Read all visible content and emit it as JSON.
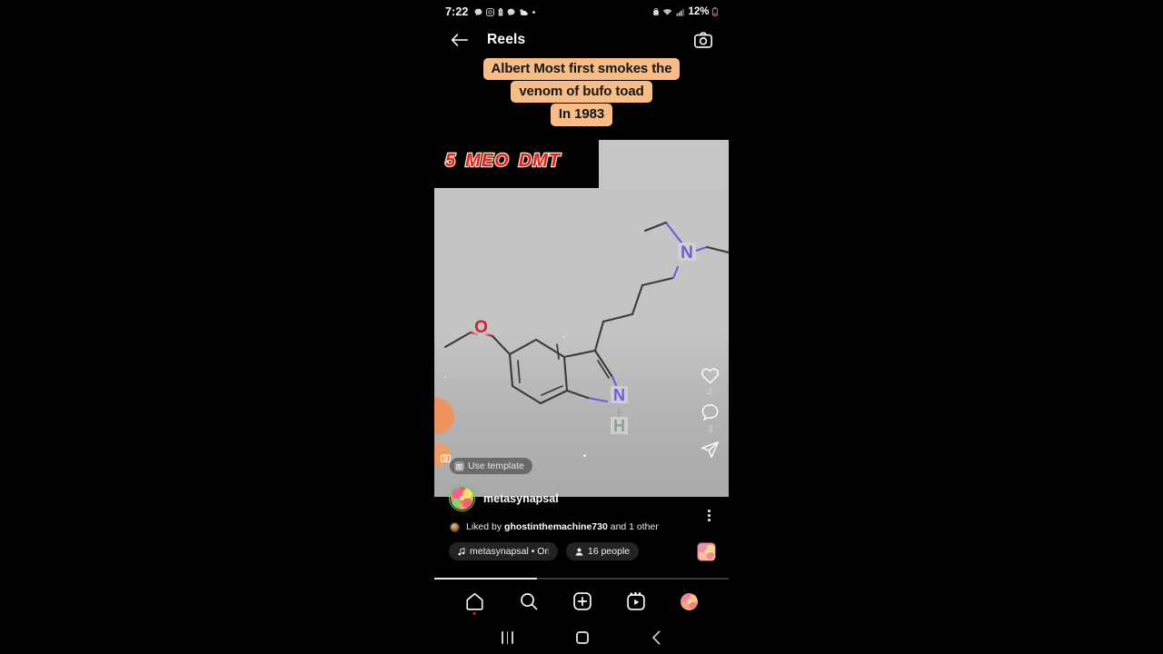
{
  "statusbar": {
    "time": "7:22",
    "battery_percent": "12%",
    "left_icons": [
      "chat-bubble-icon",
      "instagram-icon",
      "battery-alert-icon",
      "messenger-icon",
      "weather-icon",
      "more-dot-icon"
    ],
    "right_icons": [
      "alarm-icon",
      "wifi-icon",
      "cellular-signal-icon",
      "battery-low-icon"
    ]
  },
  "header": {
    "title": "Reels",
    "back_label": "back-arrow",
    "camera_label": "camera"
  },
  "caption": {
    "lines": [
      "Albert Most  first smokes the",
      "venom of bufo toad",
      "In 1983"
    ],
    "background_color": "#f7bd84",
    "text_color": "#151515"
  },
  "video": {
    "brand_words": [
      "5",
      "MEO",
      "DMT"
    ],
    "brand_color": "#f41a1a",
    "brand_outline_color": "#f6ead0",
    "background_color": "#c6c6c6",
    "molecule": {
      "name": "5-MeO-DMT",
      "atom_labels": [
        "O",
        "N",
        "N",
        "H"
      ],
      "oxygen_color": "#d41e2e",
      "nitrogen_color": "#6b5ce0",
      "hydrogen_color": "#7f9a86",
      "bond_color": "#3a3a3a"
    },
    "use_template_label": "Use template"
  },
  "actions": {
    "like": {
      "icon": "heart-icon",
      "count": "2"
    },
    "comment": {
      "icon": "comment-icon",
      "count": "3"
    },
    "share": {
      "icon": "send-icon",
      "count": ""
    }
  },
  "post": {
    "username": "metasynapsal",
    "liked_by": "Liked by ",
    "liked_by_name": "ghostinthemachine730",
    "liked_by_suffix": " and 1 other",
    "audio_pill": "metasynapsal • Original",
    "people_pill": "16 people",
    "menu": "more-options"
  },
  "progress": {
    "percent": "35"
  },
  "bottomnav": {
    "items": [
      {
        "name": "home",
        "icon": "home-icon",
        "badge": true
      },
      {
        "name": "search",
        "icon": "search-icon",
        "badge": false
      },
      {
        "name": "create",
        "icon": "plus-square-icon",
        "badge": false
      },
      {
        "name": "reels",
        "icon": "reels-icon",
        "badge": false
      },
      {
        "name": "profile",
        "icon": "avatar-icon",
        "badge": false
      }
    ]
  },
  "sysnav": {
    "recents": "recents-button",
    "home": "home-button",
    "back": "back-button"
  }
}
